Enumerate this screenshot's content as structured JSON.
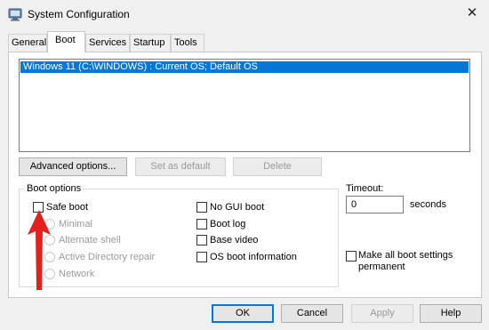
{
  "window": {
    "title": "System Configuration",
    "icon": "system-config-icon",
    "close_glyph": "✕"
  },
  "tabs": [
    {
      "label": "General"
    },
    {
      "label": "Boot",
      "active": true
    },
    {
      "label": "Services"
    },
    {
      "label": "Startup"
    },
    {
      "label": "Tools"
    }
  ],
  "os_list": {
    "entries": [
      "Windows 11 (C:\\WINDOWS) : Current OS; Default OS"
    ],
    "selected_index": 0
  },
  "buttons": {
    "advanced": "Advanced options...",
    "set_default": "Set as default",
    "delete": "Delete",
    "ok": "OK",
    "cancel": "Cancel",
    "apply": "Apply",
    "help": "Help"
  },
  "boot_options": {
    "legend": "Boot options",
    "safe_boot": {
      "label": "Safe boot",
      "checked": false
    },
    "radios": [
      {
        "label": "Minimal",
        "enabled": false
      },
      {
        "label": "Alternate shell",
        "enabled": false
      },
      {
        "label": "Active Directory repair",
        "enabled": false
      },
      {
        "label": "Network",
        "enabled": false
      }
    ],
    "right_checks": [
      {
        "label": "No GUI boot",
        "checked": false
      },
      {
        "label": "Boot log",
        "checked": false
      },
      {
        "label": "Base video",
        "checked": false
      },
      {
        "label": "OS boot information",
        "checked": false
      }
    ]
  },
  "timeout": {
    "label": "Timeout:",
    "value": "0",
    "unit": "seconds"
  },
  "make_permanent": {
    "line1": "Make all boot settings",
    "line2": "permanent",
    "checked": false
  },
  "colors": {
    "selection": "#0078d7",
    "annotation_arrow": "#e3211b",
    "dialog_bg": "#f0f0f0"
  }
}
